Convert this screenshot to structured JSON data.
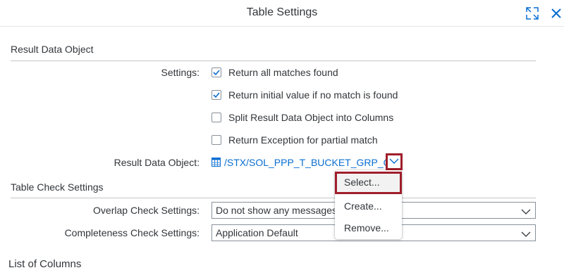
{
  "dialog": {
    "title": "Table Settings",
    "icons": {
      "fullscreen": "fullscreen-icon",
      "close": "close-icon"
    }
  },
  "result_section": {
    "title": "Result Data Object",
    "settings_label": "Settings:",
    "checkboxes": [
      {
        "label": "Return all matches found",
        "checked": true
      },
      {
        "label": "Return initial value if no match is found",
        "checked": true
      },
      {
        "label": "Split Result Data Object into Columns",
        "checked": false
      },
      {
        "label": "Return Exception for partial match",
        "checked": false
      }
    ],
    "object_label": "Result Data Object:",
    "object_value": "/STX/SOL_PPP_T_BUCKET_GRP_O",
    "object_icon": "table-icon"
  },
  "check_section": {
    "title": "Table Check Settings",
    "overlap_label": "Overlap Check Settings:",
    "overlap_value": "Do not show any messages",
    "completeness_label": "Completeness Check Settings:",
    "completeness_value": "Application Default"
  },
  "menu": {
    "items": [
      "Select...",
      "Create...",
      "Remove..."
    ]
  },
  "columns_section": {
    "title": "List of Columns"
  },
  "colors": {
    "accent": "#0a6ed1",
    "highlight_border": "#a01e2a",
    "text": "#32363a"
  }
}
